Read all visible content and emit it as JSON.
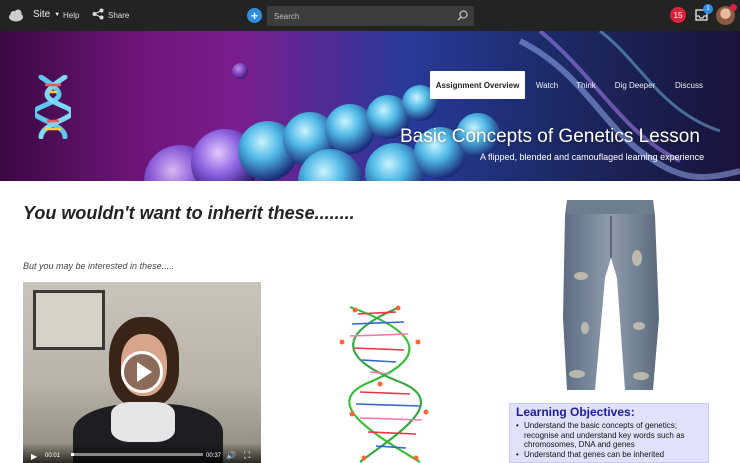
{
  "topbar": {
    "site_label": "Site",
    "help_label": "Help",
    "share_label": "Share",
    "search_placeholder": "Search",
    "notification_count": "15",
    "inbox_count": "1",
    "icons": [
      "cloud-logo-icon",
      "chevron-down-icon",
      "share-icon",
      "plus-icon",
      "search-icon",
      "apps-grid-icon",
      "inbox-icon",
      "avatar"
    ]
  },
  "banner": {
    "tabs": [
      {
        "label": "Assignment Overview",
        "active": true
      },
      {
        "label": "Watch",
        "active": false
      },
      {
        "label": "Think",
        "active": false
      },
      {
        "label": "Dig Deeper",
        "active": false
      },
      {
        "label": "Discuss",
        "active": false
      }
    ],
    "title": "Basic Concepts of Genetics Lesson",
    "subtitle": "A flipped, blended and camouflaged learning experience"
  },
  "content": {
    "heading": "You wouldn't want to inherit these........",
    "subheading": "But you may be interested in these.....",
    "video": {
      "current_time": "00:01",
      "duration": "00:37",
      "progress": 0.02
    },
    "objectives": {
      "title": "Learning Objectives:",
      "items": [
        "Understand the basic concepts of genetics; recognise and understand key words such as chromosomes, DNA and genes",
        "Understand that genes can be inherited"
      ]
    }
  },
  "colors": {
    "topbar_bg": "#232323",
    "accent_blue": "#2f8ee0",
    "badge_red": "#d9223b",
    "objectives_bg": "#e1e1fb",
    "objectives_title": "#1c1c9a"
  }
}
